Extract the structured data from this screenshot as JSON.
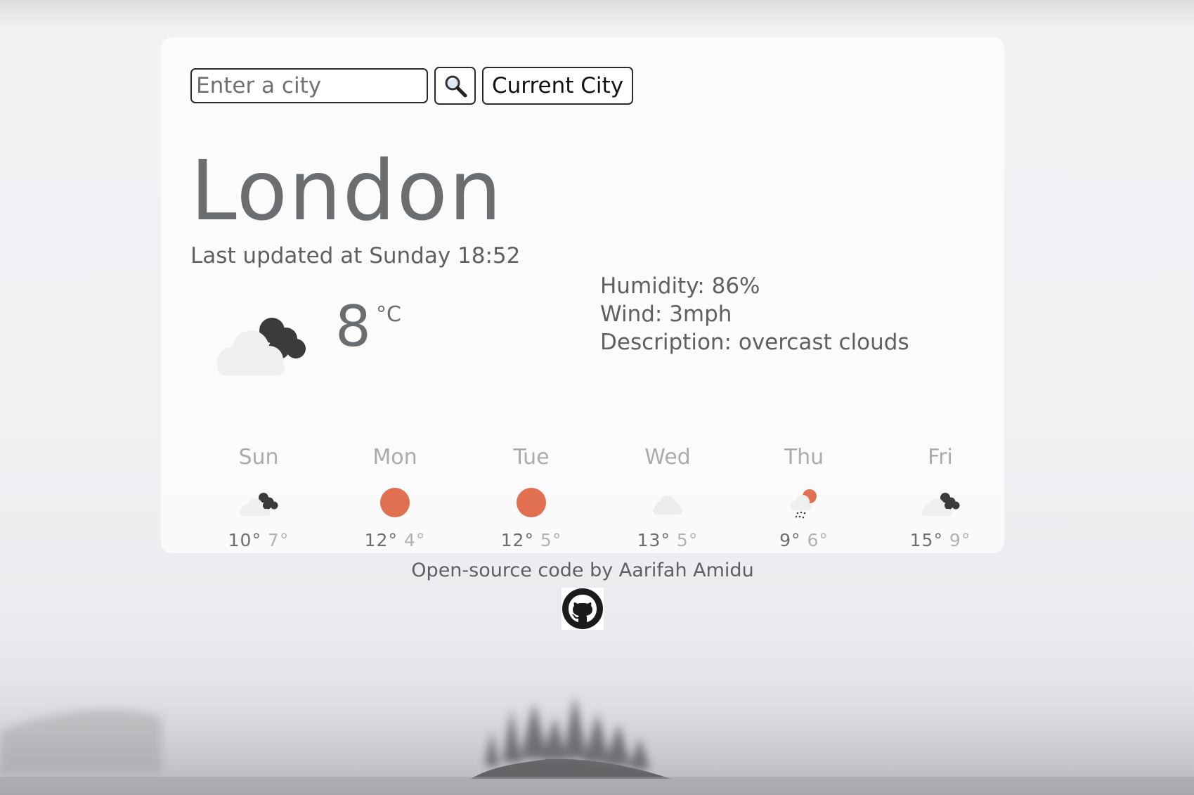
{
  "search": {
    "placeholder": "Enter a city",
    "search_icon": "magnifier-icon",
    "current_city_label": "Current City"
  },
  "current": {
    "city": "London",
    "updated": "Last updated at Sunday 18:52",
    "temperature": "8",
    "unit": "°C",
    "icon": "cloud-icon",
    "humidity": "Humidity: 86%",
    "wind": "Wind: 3mph",
    "description": "Description: overcast clouds"
  },
  "forecast": [
    {
      "day": "Sun",
      "icon": "cloud-icon",
      "max": "10°",
      "min": "7°"
    },
    {
      "day": "Mon",
      "icon": "sun-icon",
      "max": "12°",
      "min": "4°"
    },
    {
      "day": "Tue",
      "icon": "sun-icon",
      "max": "12°",
      "min": "5°"
    },
    {
      "day": "Wed",
      "icon": "light-cloud-icon",
      "max": "13°",
      "min": "5°"
    },
    {
      "day": "Thu",
      "icon": "rain-icon",
      "max": "9°",
      "min": "6°"
    },
    {
      "day": "Fri",
      "icon": "cloud-icon",
      "max": "15°",
      "min": "9°"
    }
  ],
  "footer": {
    "text": "Open-source code by Aarifah Amidu",
    "github_icon": "github-icon"
  },
  "colors": {
    "sun": "#e07050",
    "dark_cloud": "#3a3b3d",
    "light_cloud": "#efefef",
    "text": "#5d6063"
  }
}
